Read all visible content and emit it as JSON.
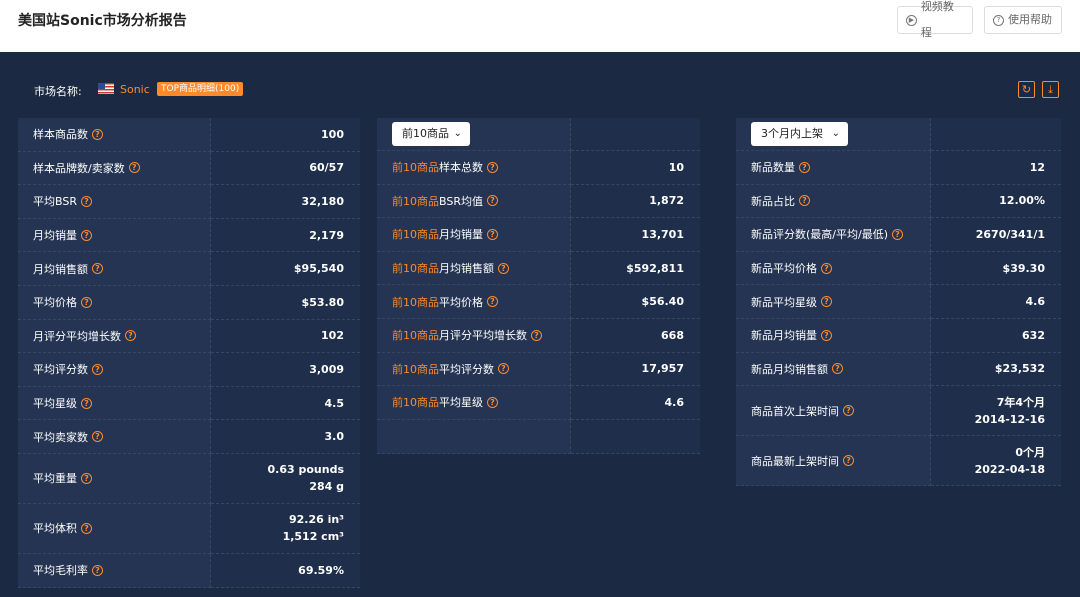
{
  "header": {
    "title": "美国站Sonic市场分析报告",
    "video_btn": "视频教程",
    "help_btn": "使用帮助"
  },
  "market": {
    "label": "市场名称:",
    "name": "Sonic",
    "badge": "TOP商品明细(100)"
  },
  "colors": {
    "accent": "#ff8a2b",
    "panel_bg": "#1b2942",
    "label_bg": "#243452",
    "value_bg": "#1f2e4a"
  },
  "overall": [
    {
      "label": "样本商品数",
      "value": "100"
    },
    {
      "label": "样本品牌数/卖家数",
      "value": "60/57"
    },
    {
      "label": "平均BSR",
      "value": "32,180"
    },
    {
      "label": "月均销量",
      "value": "2,179"
    },
    {
      "label": "月均销售额",
      "value": "$95,540"
    },
    {
      "label": "平均价格",
      "value": "$53.80"
    },
    {
      "label": "月评分平均增长数",
      "value": "102"
    },
    {
      "label": "平均评分数",
      "value": "3,009"
    },
    {
      "label": "平均星级",
      "value": "4.5"
    },
    {
      "label": "平均卖家数",
      "value": "3.0"
    },
    {
      "label": "平均重量",
      "value": "0.63 pounds",
      "value2": "284 g"
    },
    {
      "label": "平均体积",
      "value": "92.26 in³",
      "value2": "1,512 cm³"
    },
    {
      "label": "平均毛利率",
      "value": "69.59%"
    }
  ],
  "top": {
    "select": "前10商品",
    "prefix": "前10商品",
    "rows": [
      {
        "suffix": "样本总数",
        "value": "10"
      },
      {
        "suffix": "BSR均值",
        "value": "1,872"
      },
      {
        "suffix": "月均销量",
        "value": "13,701"
      },
      {
        "suffix": "月均销售额",
        "value": "$592,811"
      },
      {
        "suffix": "平均价格",
        "value": "$56.40"
      },
      {
        "suffix": "月评分平均增长数",
        "value": "668"
      },
      {
        "suffix": "平均评分数",
        "value": "17,957"
      },
      {
        "suffix": "平均星级",
        "value": "4.6"
      }
    ]
  },
  "new": {
    "select": "3个月内上架",
    "rows": [
      {
        "label": "新品数量",
        "value": "12"
      },
      {
        "label": "新品占比",
        "value": "12.00%"
      },
      {
        "label": "新品评分数(最高/平均/最低)",
        "value": "2670/341/1"
      },
      {
        "label": "新品平均价格",
        "value": "$39.30"
      },
      {
        "label": "新品平均星级",
        "value": "4.6"
      },
      {
        "label": "新品月均销量",
        "value": "632"
      },
      {
        "label": "新品月均销售额",
        "value": "$23,532"
      },
      {
        "label": "商品首次上架时间",
        "value": "7年4个月",
        "value2": "2014-12-16"
      },
      {
        "label": "商品最新上架时间",
        "value": "0个月",
        "value2": "2022-04-18"
      }
    ]
  }
}
